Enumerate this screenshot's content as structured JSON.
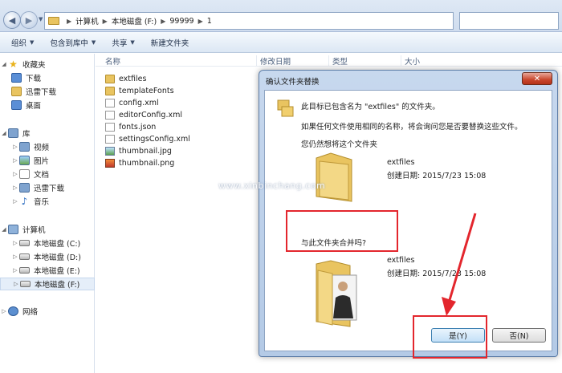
{
  "address": {
    "crumbs": [
      "计算机",
      "本地磁盘 (F:)",
      "99999",
      "1"
    ]
  },
  "toolbar": {
    "items": [
      "组织",
      "包含到库中",
      "共享",
      "新建文件夹"
    ]
  },
  "nav": {
    "favorites": "收藏夹",
    "downloads": "下载",
    "xunlei": "迅雷下载",
    "desktop": "桌面",
    "library": "库",
    "videos": "视频",
    "pictures": "图片",
    "documents": "文档",
    "xunlei_lib": "迅雷下载",
    "music": "音乐",
    "computer": "计算机",
    "drive_c": "本地磁盘 (C:)",
    "drive_d": "本地磁盘 (D:)",
    "drive_e": "本地磁盘 (E:)",
    "drive_f": "本地磁盘 (F:)",
    "network": "网络"
  },
  "files": {
    "columns": {
      "name": "名称",
      "modified": "修改日期",
      "type": "类型",
      "size": "大小"
    },
    "items": [
      "extfiles",
      "templateFonts",
      "config.xml",
      "editorConfig.xml",
      "fonts.json",
      "settingsConfig.xml",
      "thumbnail.jpg",
      "thumbnail.png"
    ]
  },
  "dialog": {
    "title": "确认文件夹替换",
    "close": "✕",
    "line1": "此目标已包含名为 \"extfiles\" 的文件夹。",
    "line2": "如果任何文件使用相同的名称，将会询问您是否要替换这些文件。",
    "line3": "您仍然想将这个文件夹",
    "folder1_name": "extfiles",
    "folder1_date": "创建日期: 2015/7/23 15:08",
    "merge_question": "与此文件夹合并吗?",
    "folder2_name": "extfiles",
    "folder2_date": "创建日期: 2015/7/23 15:08",
    "yes": "是(Y)",
    "no": "否(N)"
  },
  "watermark": "www.xinbinchang.com",
  "colors": {
    "annotation_red": "#e3262d",
    "folder_yellow": "#e9c460",
    "dialog_frame": "#b4cae6"
  }
}
